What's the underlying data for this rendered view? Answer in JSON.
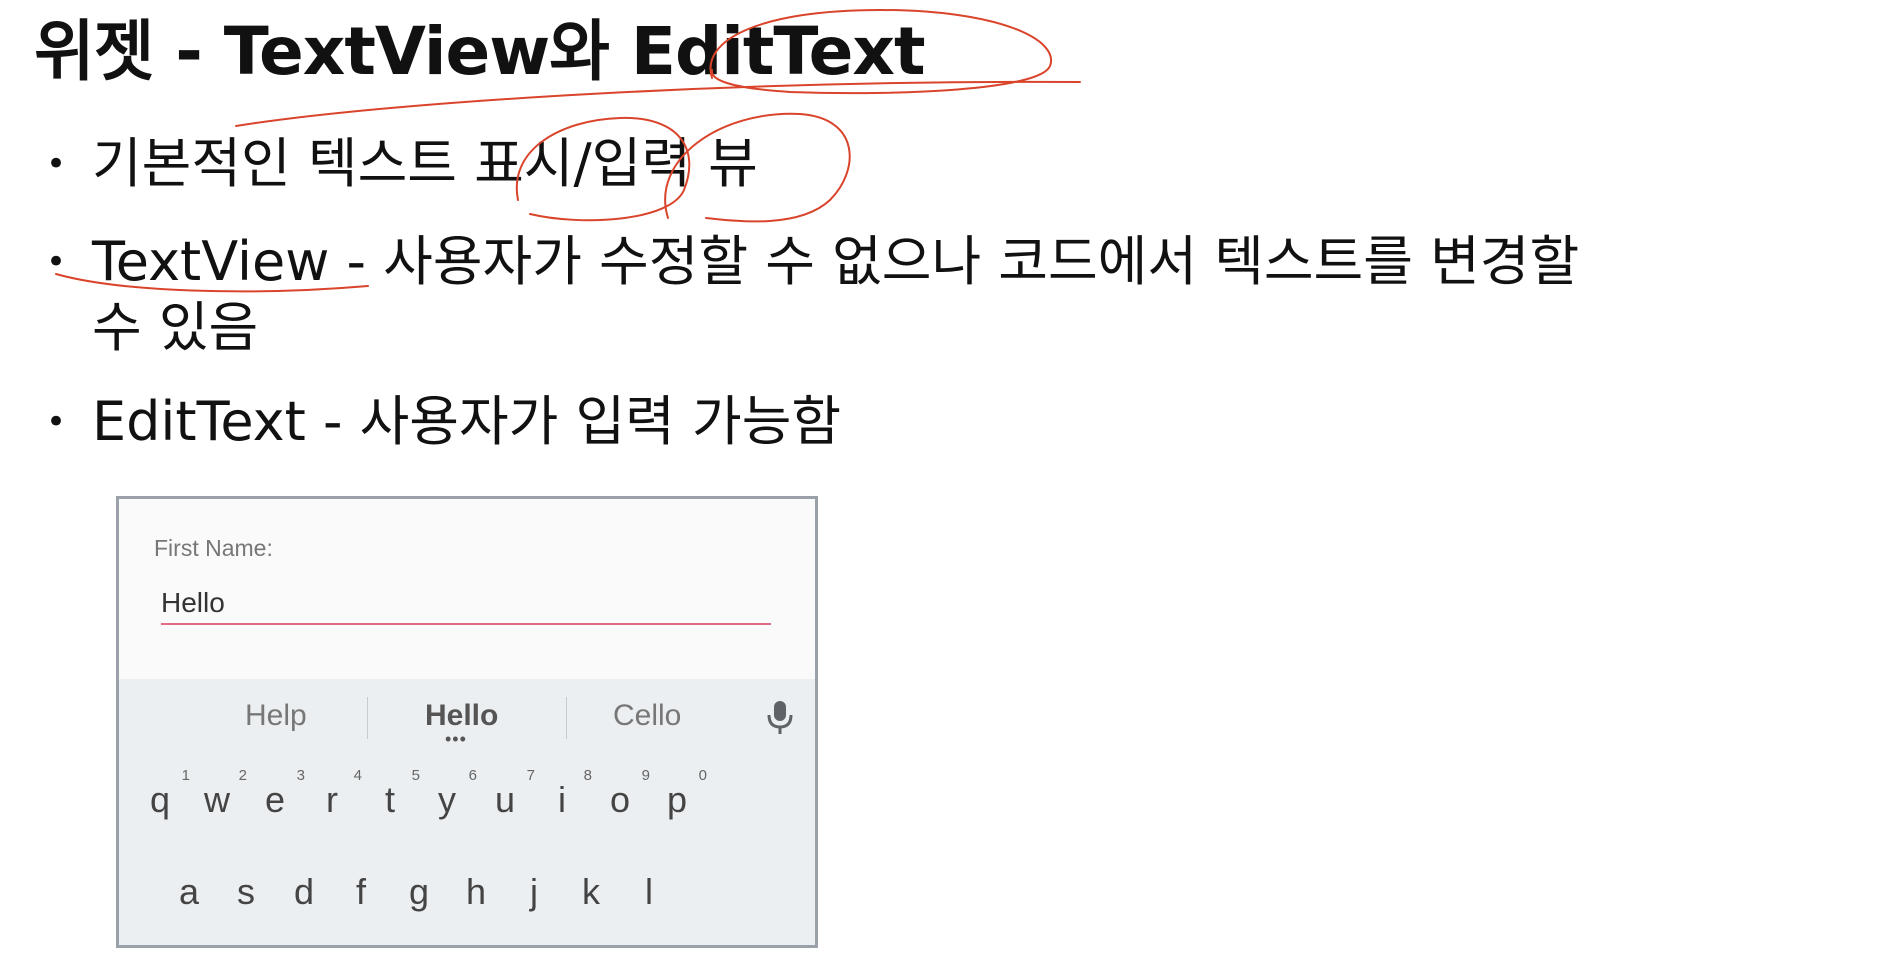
{
  "title": "위젯 - TextView와 EditText",
  "bullets": [
    {
      "text": "기본적인 텍스트 표시/입력 뷰"
    },
    {
      "text": "TextView - 사용자가 수정할 수 없으나 코드에서 텍스트를 변경할",
      "continuation": "수 있음"
    },
    {
      "text": "EditText - 사용자가 입력 가능함"
    }
  ],
  "phone": {
    "label": "First Name:",
    "input_value": "Hello",
    "suggestions": [
      "Help",
      "Hello",
      "Cello"
    ],
    "suggestion_dots": "•••",
    "row1": [
      {
        "key": "q",
        "hint": "1"
      },
      {
        "key": "w",
        "hint": "2"
      },
      {
        "key": "e",
        "hint": "3"
      },
      {
        "key": "r",
        "hint": "4"
      },
      {
        "key": "t",
        "hint": "5"
      },
      {
        "key": "y",
        "hint": "6"
      },
      {
        "key": "u",
        "hint": "7"
      },
      {
        "key": "i",
        "hint": "8"
      },
      {
        "key": "o",
        "hint": "9"
      },
      {
        "key": "p",
        "hint": "0"
      }
    ],
    "row2": [
      "a",
      "s",
      "d",
      "f",
      "g",
      "h",
      "j",
      "k",
      "l"
    ]
  },
  "colors": {
    "annotation": "#d9442b",
    "input_underline": "#e26a86"
  },
  "icons": {
    "mic": "mic-icon",
    "bullet": "bullet-dot"
  }
}
